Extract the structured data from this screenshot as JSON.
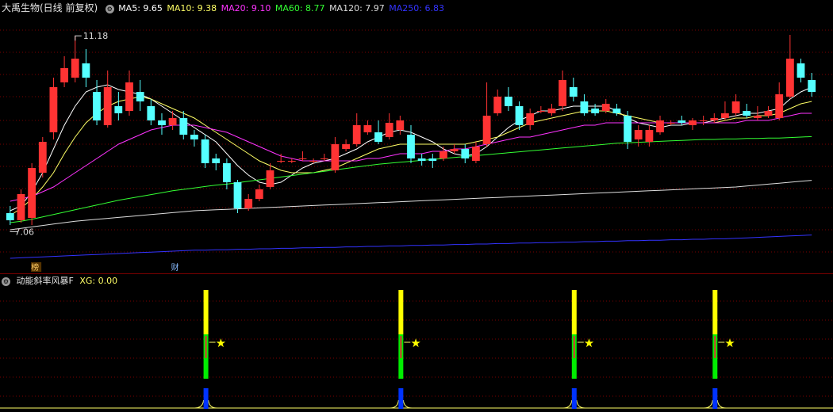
{
  "header": {
    "title": "大禹生物(日线 前复权)",
    "ma": [
      {
        "label": "MA5: 9.65",
        "color": "#ffffff"
      },
      {
        "label": "MA10: 9.38",
        "color": "#ffff66"
      },
      {
        "label": "MA20: 9.10",
        "color": "#ff33ff"
      },
      {
        "label": "MA60: 8.77",
        "color": "#33ff33"
      },
      {
        "label": "MA120: 7.97",
        "color": "#dddddd"
      },
      {
        "label": "MA250: 6.83",
        "color": "#3333ff"
      }
    ]
  },
  "indicator": {
    "title": "动能斜率风暴F",
    "xg_label": "XG: 0.00"
  },
  "markers": {
    "high_label": "11.18",
    "low_label": "7.06",
    "tag1": "榜",
    "tag2": "财"
  },
  "colors": {
    "up": "#ff3333",
    "down": "#55ffff",
    "grid": "#7a0000",
    "ma5": "#ffffff",
    "ma10": "#ffff66",
    "ma20": "#ff33ff",
    "ma60": "#33ff33",
    "ma120": "#dddddd",
    "ma250": "#3333ff"
  },
  "chart_data": {
    "type": "candlestick",
    "price_range": [
      6.4,
      11.6
    ],
    "candles": [
      [
        7.45,
        7.3,
        7.6,
        7.2
      ],
      [
        7.3,
        7.85,
        7.95,
        7.25
      ],
      [
        7.35,
        8.4,
        8.5,
        7.2
      ],
      [
        8.3,
        8.95,
        9.05,
        8.2
      ],
      [
        9.15,
        10.1,
        10.3,
        9.0
      ],
      [
        10.2,
        10.5,
        10.75,
        10.1
      ],
      [
        10.3,
        10.7,
        11.18,
        10.2
      ],
      [
        10.6,
        10.3,
        10.9,
        10.1
      ],
      [
        10.0,
        9.4,
        10.25,
        9.3
      ],
      [
        9.3,
        10.1,
        10.45,
        9.25
      ],
      [
        9.7,
        9.55,
        10.0,
        9.4
      ],
      [
        9.6,
        10.2,
        10.45,
        9.5
      ],
      [
        10.0,
        9.8,
        10.25,
        9.6
      ],
      [
        9.7,
        9.4,
        9.85,
        9.3
      ],
      [
        9.4,
        9.3,
        9.55,
        9.1
      ],
      [
        9.3,
        9.45,
        9.6,
        9.2
      ],
      [
        9.45,
        9.1,
        9.6,
        9.0
      ],
      [
        9.1,
        9.0,
        9.2,
        8.85
      ],
      [
        9.0,
        8.5,
        9.1,
        8.4
      ],
      [
        8.6,
        8.5,
        8.7,
        8.35
      ],
      [
        8.5,
        8.1,
        8.6,
        7.95
      ],
      [
        8.1,
        7.55,
        8.15,
        7.45
      ],
      [
        7.55,
        7.75,
        7.85,
        7.5
      ],
      [
        7.75,
        7.95,
        8.05,
        7.7
      ],
      [
        8.0,
        8.35,
        8.5,
        7.95
      ],
      [
        8.55,
        8.55,
        8.7,
        8.5
      ],
      [
        8.55,
        8.55,
        8.6,
        8.5
      ],
      [
        8.6,
        8.6,
        8.75,
        8.55
      ],
      [
        8.55,
        8.55,
        8.6,
        8.5
      ],
      [
        8.6,
        8.6,
        8.7,
        8.55
      ],
      [
        8.35,
        8.9,
        9.05,
        8.3
      ],
      [
        8.8,
        8.9,
        9.0,
        8.75
      ],
      [
        8.9,
        9.3,
        9.55,
        8.85
      ],
      [
        9.15,
        9.3,
        9.4,
        9.1
      ],
      [
        9.15,
        8.95,
        9.4,
        8.9
      ],
      [
        9.05,
        9.35,
        9.55,
        9.0
      ],
      [
        9.2,
        9.4,
        9.5,
        9.1
      ],
      [
        9.1,
        8.6,
        9.3,
        8.5
      ],
      [
        8.6,
        8.55,
        8.7,
        8.45
      ],
      [
        8.6,
        8.55,
        8.7,
        8.4
      ],
      [
        8.6,
        8.75,
        8.85,
        8.55
      ],
      [
        8.75,
        8.8,
        8.9,
        8.7
      ],
      [
        8.8,
        8.6,
        8.9,
        8.5
      ],
      [
        8.55,
        8.85,
        8.95,
        8.5
      ],
      [
        8.9,
        9.5,
        10.2,
        8.85
      ],
      [
        9.55,
        9.9,
        10.05,
        9.5
      ],
      [
        9.9,
        9.7,
        10.1,
        9.6
      ],
      [
        9.7,
        9.3,
        9.8,
        9.2
      ],
      [
        9.3,
        9.55,
        9.65,
        9.2
      ],
      [
        9.6,
        9.6,
        9.7,
        9.55
      ],
      [
        9.55,
        9.65,
        9.75,
        9.5
      ],
      [
        9.7,
        10.25,
        10.45,
        9.6
      ],
      [
        10.1,
        9.9,
        10.3,
        9.8
      ],
      [
        9.8,
        9.55,
        9.95,
        9.5
      ],
      [
        9.65,
        9.55,
        9.75,
        9.5
      ],
      [
        9.6,
        9.75,
        9.85,
        9.55
      ],
      [
        9.65,
        9.55,
        9.75,
        9.5
      ],
      [
        9.5,
        8.95,
        9.6,
        8.8
      ],
      [
        9.0,
        9.2,
        9.3,
        8.85
      ],
      [
        8.95,
        9.2,
        9.3,
        8.85
      ],
      [
        9.15,
        9.4,
        9.5,
        9.1
      ],
      [
        9.35,
        9.35,
        9.4,
        9.3
      ],
      [
        9.4,
        9.35,
        9.5,
        9.3
      ],
      [
        9.3,
        9.4,
        9.45,
        9.2
      ],
      [
        9.4,
        9.4,
        9.5,
        9.3
      ],
      [
        9.4,
        9.45,
        9.55,
        9.35
      ],
      [
        9.45,
        9.55,
        9.8,
        9.4
      ],
      [
        9.55,
        9.8,
        9.95,
        9.5
      ],
      [
        9.6,
        9.5,
        9.75,
        9.45
      ],
      [
        9.45,
        9.5,
        9.7,
        9.4
      ],
      [
        9.5,
        9.6,
        9.7,
        9.45
      ],
      [
        9.45,
        9.95,
        10.2,
        9.4
      ],
      [
        9.9,
        10.7,
        11.2,
        9.85
      ],
      [
        10.6,
        10.3,
        10.7,
        10.2
      ],
      [
        10.25,
        10.0,
        10.4,
        9.9
      ]
    ],
    "ma_series": [
      {
        "key": "ma5",
        "values": [
          7.5,
          7.6,
          7.9,
          8.3,
          8.8,
          9.3,
          9.7,
          10.0,
          10.1,
          10.15,
          10.05,
          10.0,
          9.95,
          9.85,
          9.7,
          9.55,
          9.4,
          9.25,
          9.1,
          8.95,
          8.7,
          8.45,
          8.25,
          8.1,
          8.05,
          8.1,
          8.25,
          8.4,
          8.5,
          8.55,
          8.6,
          8.7,
          8.8,
          8.95,
          9.05,
          9.15,
          9.2,
          9.15,
          9.05,
          8.95,
          8.8,
          8.7,
          8.65,
          8.7,
          8.85,
          9.05,
          9.25,
          9.4,
          9.5,
          9.6,
          9.6,
          9.65,
          9.7,
          9.7,
          9.7,
          9.7,
          9.6,
          9.45,
          9.35,
          9.3,
          9.25,
          9.3,
          9.3,
          9.35,
          9.35,
          9.4,
          9.45,
          9.5,
          9.55,
          9.55,
          9.6,
          9.65,
          9.85,
          10.0,
          10.1
        ]
      },
      {
        "key": "ma10",
        "values": [
          7.4,
          7.55,
          7.75,
          8.0,
          8.3,
          8.7,
          9.05,
          9.35,
          9.55,
          9.7,
          9.8,
          9.85,
          9.9,
          9.85,
          9.75,
          9.65,
          9.55,
          9.45,
          9.3,
          9.15,
          9.0,
          8.85,
          8.7,
          8.55,
          8.45,
          8.35,
          8.3,
          8.3,
          8.3,
          8.35,
          8.4,
          8.5,
          8.6,
          8.7,
          8.8,
          8.85,
          8.9,
          8.9,
          8.9,
          8.9,
          8.9,
          8.9,
          8.9,
          8.95,
          9.0,
          9.05,
          9.15,
          9.25,
          9.35,
          9.4,
          9.45,
          9.5,
          9.55,
          9.6,
          9.6,
          9.6,
          9.55,
          9.5,
          9.45,
          9.4,
          9.35,
          9.35,
          9.35,
          9.35,
          9.35,
          9.35,
          9.4,
          9.45,
          9.45,
          9.5,
          9.5,
          9.55,
          9.65,
          9.75,
          9.8
        ]
      },
      {
        "key": "ma20",
        "values": [
          7.7,
          7.75,
          7.8,
          7.9,
          8.0,
          8.15,
          8.3,
          8.45,
          8.6,
          8.75,
          8.9,
          9.0,
          9.1,
          9.2,
          9.25,
          9.3,
          9.3,
          9.3,
          9.25,
          9.2,
          9.15,
          9.05,
          8.95,
          8.85,
          8.75,
          8.65,
          8.6,
          8.55,
          8.55,
          8.55,
          8.55,
          8.55,
          8.55,
          8.6,
          8.6,
          8.65,
          8.7,
          8.7,
          8.7,
          8.75,
          8.75,
          8.8,
          8.8,
          8.85,
          8.9,
          8.95,
          9.0,
          9.05,
          9.05,
          9.1,
          9.15,
          9.2,
          9.25,
          9.3,
          9.3,
          9.35,
          9.35,
          9.35,
          9.35,
          9.35,
          9.35,
          9.35,
          9.35,
          9.35,
          9.35,
          9.35,
          9.35,
          9.35,
          9.4,
          9.4,
          9.4,
          9.45,
          9.5,
          9.55,
          9.55
        ]
      },
      {
        "key": "ma60",
        "values": [
          7.25,
          7.28,
          7.32,
          7.37,
          7.42,
          7.47,
          7.52,
          7.57,
          7.62,
          7.67,
          7.72,
          7.76,
          7.8,
          7.84,
          7.88,
          7.92,
          7.95,
          7.98,
          8.01,
          8.04,
          8.06,
          8.09,
          8.12,
          8.15,
          8.18,
          8.21,
          8.24,
          8.27,
          8.3,
          8.33,
          8.36,
          8.39,
          8.42,
          8.45,
          8.48,
          8.5,
          8.52,
          8.54,
          8.56,
          8.58,
          8.6,
          8.62,
          8.64,
          8.66,
          8.68,
          8.7,
          8.72,
          8.74,
          8.76,
          8.78,
          8.8,
          8.82,
          8.84,
          8.86,
          8.88,
          8.9,
          8.92,
          8.93,
          8.94,
          8.95,
          8.96,
          8.97,
          8.98,
          8.99,
          9.0,
          9.0,
          9.01,
          9.01,
          9.02,
          9.02,
          9.03,
          9.03,
          9.04,
          9.05,
          9.06
        ]
      },
      {
        "key": "ma120",
        "values": [
          7.1,
          7.13,
          7.16,
          7.19,
          7.22,
          7.25,
          7.28,
          7.3,
          7.32,
          7.34,
          7.36,
          7.38,
          7.4,
          7.42,
          7.44,
          7.46,
          7.48,
          7.5,
          7.51,
          7.52,
          7.53,
          7.54,
          7.55,
          7.56,
          7.57,
          7.58,
          7.59,
          7.6,
          7.61,
          7.62,
          7.63,
          7.64,
          7.65,
          7.66,
          7.67,
          7.68,
          7.69,
          7.7,
          7.71,
          7.72,
          7.73,
          7.74,
          7.75,
          7.76,
          7.77,
          7.78,
          7.79,
          7.8,
          7.81,
          7.82,
          7.83,
          7.84,
          7.85,
          7.86,
          7.87,
          7.88,
          7.89,
          7.9,
          7.91,
          7.92,
          7.93,
          7.94,
          7.95,
          7.96,
          7.97,
          7.98,
          7.99,
          8.0,
          8.02,
          8.04,
          8.06,
          8.08,
          8.1,
          8.12,
          8.14
        ]
      },
      {
        "key": "ma250",
        "values": [
          6.5,
          6.51,
          6.52,
          6.53,
          6.54,
          6.55,
          6.56,
          6.57,
          6.58,
          6.59,
          6.6,
          6.61,
          6.62,
          6.63,
          6.64,
          6.65,
          6.66,
          6.67,
          6.67,
          6.68,
          6.68,
          6.69,
          6.69,
          6.7,
          6.7,
          6.71,
          6.71,
          6.72,
          6.72,
          6.73,
          6.73,
          6.74,
          6.74,
          6.75,
          6.75,
          6.76,
          6.76,
          6.77,
          6.77,
          6.78,
          6.78,
          6.79,
          6.79,
          6.8,
          6.8,
          6.81,
          6.81,
          6.82,
          6.82,
          6.83,
          6.83,
          6.84,
          6.84,
          6.85,
          6.85,
          6.86,
          6.86,
          6.87,
          6.87,
          6.88,
          6.88,
          6.89,
          6.89,
          6.9,
          6.9,
          6.91,
          6.91,
          6.92,
          6.93,
          6.94,
          6.95,
          6.96,
          6.97,
          6.98,
          6.99
        ]
      }
    ],
    "signals": [
      {
        "index": 18
      },
      {
        "index": 36
      },
      {
        "index": 52
      },
      {
        "index": 65
      }
    ]
  }
}
